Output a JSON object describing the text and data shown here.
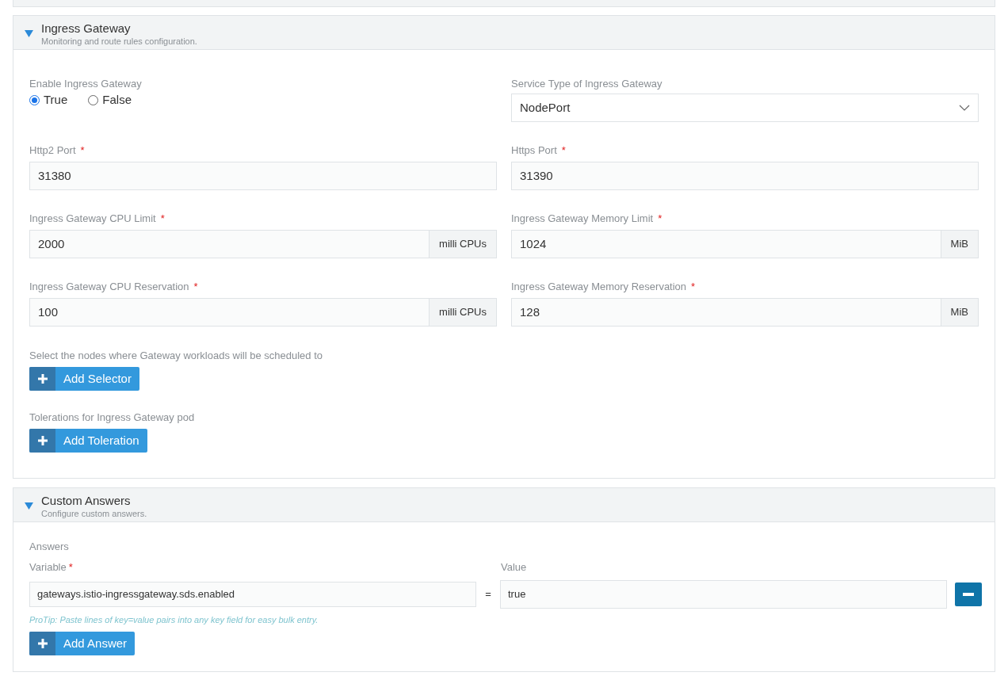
{
  "ingress_gateway": {
    "title": "Ingress Gateway",
    "subtitle": "Monitoring and route rules configuration.",
    "expanded": true,
    "fields": [
      {
        "kind": "radio",
        "label": "Enable Ingress Gateway",
        "options": [
          {
            "label": "True",
            "selected": true
          },
          {
            "label": "False",
            "selected": false
          }
        ]
      },
      {
        "kind": "select",
        "label": "Service Type of Ingress Gateway",
        "value": "NodePort"
      },
      {
        "kind": "text",
        "label": "Http2 Port",
        "required_mark": "*",
        "value": "31380"
      },
      {
        "kind": "text",
        "label": "Https Port",
        "required_mark": "*",
        "value": "31390"
      },
      {
        "kind": "addon",
        "label": "Ingress Gateway CPU Limit",
        "required_mark": "*",
        "value": "2000",
        "unit": "milli CPUs"
      },
      {
        "kind": "addon",
        "label": "Ingress Gateway Memory Limit",
        "required_mark": "*",
        "value": "1024",
        "unit": "MiB"
      },
      {
        "kind": "addon",
        "label": "Ingress Gateway CPU Reservation",
        "required_mark": "*",
        "value": "100",
        "unit": "milli CPUs"
      },
      {
        "kind": "addon",
        "label": "Ingress Gateway Memory Reservation",
        "required_mark": "*",
        "value": "128",
        "unit": "MiB"
      }
    ],
    "add_blocks": [
      {
        "label": "Select the nodes where Gateway workloads will be scheduled to",
        "button": "Add Selector"
      },
      {
        "label": "Tolerations for Ingress Gateway pod",
        "button": "Add Toleration"
      }
    ]
  },
  "custom_answers": {
    "title": "Custom Answers",
    "subtitle": "Configure custom answers.",
    "expanded": true,
    "answers_label": "Answers",
    "variable_label": "Variable",
    "variable_required_mark": "*",
    "value_label": "Value",
    "rows": [
      {
        "key": "gateways.istio-ingressgateway.sds.enabled",
        "separator": "=",
        "value": "true"
      }
    ],
    "protip": "ProTip: Paste lines of key=value pairs into any key field for easy bulk entry.",
    "add_button": "Add Answer"
  }
}
